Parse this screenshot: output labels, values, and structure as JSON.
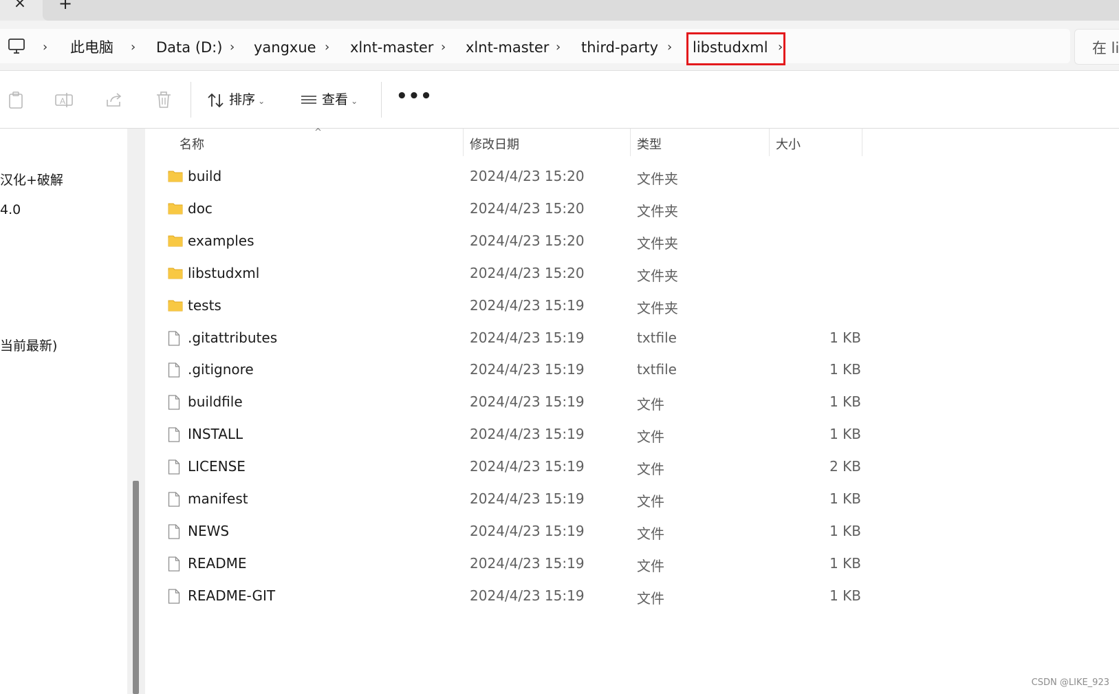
{
  "tabs": {
    "close_icon": "×",
    "new_icon": "+"
  },
  "breadcrumb": {
    "items": [
      "此电脑",
      "Data (D:)",
      "yangxue",
      "xlnt-master",
      "xlnt-master",
      "third-party",
      "libstudxml"
    ],
    "separator": "›",
    "search_placeholder": "在 li"
  },
  "toolbar": {
    "sort_label": "排序",
    "view_label": "查看",
    "more_label": "•••",
    "chevron": "⌄"
  },
  "nav": {
    "items": [
      "汉化+破解",
      "4.0",
      "当前最新)"
    ]
  },
  "columns": {
    "name": "名称",
    "date": "修改日期",
    "type": "类型",
    "size": "大小",
    "sort_caret": "^"
  },
  "files": [
    {
      "name": "build",
      "date": "2024/4/23 15:20",
      "type": "文件夹",
      "size": "",
      "icon": "folder-icon"
    },
    {
      "name": "doc",
      "date": "2024/4/23 15:20",
      "type": "文件夹",
      "size": "",
      "icon": "folder-icon"
    },
    {
      "name": "examples",
      "date": "2024/4/23 15:20",
      "type": "文件夹",
      "size": "",
      "icon": "folder-icon"
    },
    {
      "name": "libstudxml",
      "date": "2024/4/23 15:20",
      "type": "文件夹",
      "size": "",
      "icon": "folder-icon"
    },
    {
      "name": "tests",
      "date": "2024/4/23 15:19",
      "type": "文件夹",
      "size": "",
      "icon": "folder-icon"
    },
    {
      "name": ".gitattributes",
      "date": "2024/4/23 15:19",
      "type": "txtfile",
      "size": "1 KB",
      "icon": "file-icon"
    },
    {
      "name": ".gitignore",
      "date": "2024/4/23 15:19",
      "type": "txtfile",
      "size": "1 KB",
      "icon": "file-icon"
    },
    {
      "name": "buildfile",
      "date": "2024/4/23 15:19",
      "type": "文件",
      "size": "1 KB",
      "icon": "file-icon"
    },
    {
      "name": "INSTALL",
      "date": "2024/4/23 15:19",
      "type": "文件",
      "size": "1 KB",
      "icon": "file-icon"
    },
    {
      "name": "LICENSE",
      "date": "2024/4/23 15:19",
      "type": "文件",
      "size": "2 KB",
      "icon": "file-icon"
    },
    {
      "name": "manifest",
      "date": "2024/4/23 15:19",
      "type": "文件",
      "size": "1 KB",
      "icon": "file-icon"
    },
    {
      "name": "NEWS",
      "date": "2024/4/23 15:19",
      "type": "文件",
      "size": "1 KB",
      "icon": "file-icon"
    },
    {
      "name": "README",
      "date": "2024/4/23 15:19",
      "type": "文件",
      "size": "1 KB",
      "icon": "file-icon"
    },
    {
      "name": "README-GIT",
      "date": "2024/4/23 15:19",
      "type": "文件",
      "size": "1 KB",
      "icon": "file-icon"
    }
  ],
  "colors": {
    "highlight_border": "#e3191c",
    "folder_fill": "#f8c843"
  },
  "watermark": "CSDN @LIKE_923"
}
